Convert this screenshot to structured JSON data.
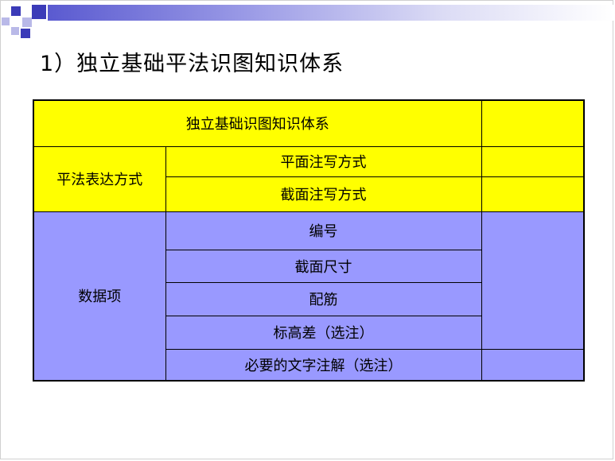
{
  "slide": {
    "title": "1）独立基础平法识图知识体系"
  },
  "table": {
    "header": "独立基础识图知识体系",
    "group1": {
      "label": "平法表达方式",
      "items": [
        "平面注写方式",
        "截面注写方式"
      ]
    },
    "group2": {
      "label": "数据项",
      "items": [
        "编号",
        "截面尺寸",
        "配筋",
        "标高差（选注）",
        "必要的文字注解（选注）"
      ]
    }
  },
  "colors": {
    "yellow": "#ffff00",
    "periwinkle": "#9999ff",
    "accent": "#3b3bb8"
  }
}
